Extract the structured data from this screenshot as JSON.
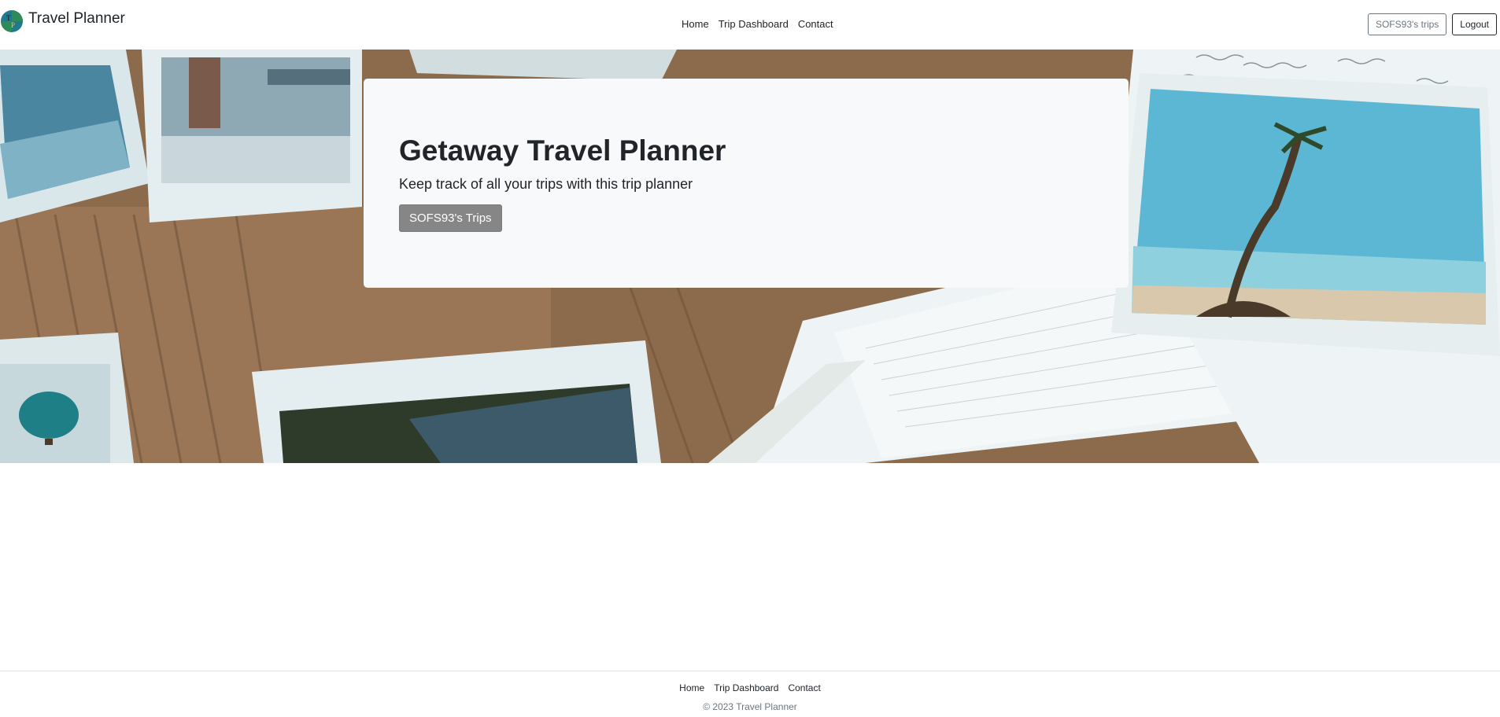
{
  "brand": {
    "logo_letters": "TP",
    "name": "Travel Planner"
  },
  "nav": {
    "items": [
      {
        "label": "Home"
      },
      {
        "label": "Trip Dashboard"
      },
      {
        "label": "Contact"
      }
    ],
    "user_trips_label": "SOFS93's trips",
    "logout_label": "Logout"
  },
  "hero": {
    "title": "Getaway Travel Planner",
    "subtitle": "Keep track of all your trips with this trip planner",
    "button_label": "SOFS93's Trips",
    "background_image": "scattered-travel-photos-on-wooden-table"
  },
  "footer": {
    "items": [
      {
        "label": "Home"
      },
      {
        "label": "Trip Dashboard"
      },
      {
        "label": "Contact"
      }
    ],
    "copyright": "© 2023 Travel Planner"
  },
  "colors": {
    "text": "#212529",
    "muted": "#6c757d",
    "card_bg": "#f8f9fa",
    "button_gray": "#868686"
  }
}
